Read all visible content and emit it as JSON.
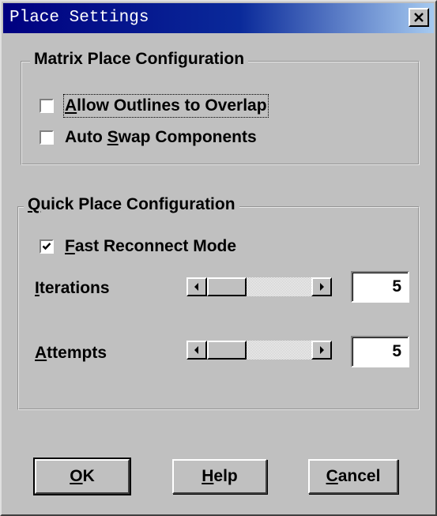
{
  "window": {
    "title": "Place Settings",
    "close_icon": "close-icon"
  },
  "matrix": {
    "title": "Matrix Place Configuration",
    "allow_outlines": {
      "pre": "",
      "mn": "A",
      "post": "llow Outlines to Overlap",
      "checked": false
    },
    "auto_swap": {
      "pre": "Auto ",
      "mn": "S",
      "post": "wap Components",
      "checked": false
    }
  },
  "quick": {
    "title_mn": "Q",
    "title_post": "uick Place Configuration",
    "fast_reconnect": {
      "mn": "F",
      "post": "ast Reconnect Mode",
      "checked": true
    },
    "iterations": {
      "label_mn": "I",
      "label_post": "terations",
      "value": "5"
    },
    "attempts": {
      "label_mn": "A",
      "label_post": "ttempts",
      "value": "5"
    }
  },
  "buttons": {
    "ok": {
      "mn": "O",
      "post": "K"
    },
    "help": {
      "mn": "H",
      "post": "elp"
    },
    "cancel": {
      "mn": "C",
      "post": "ancel"
    }
  }
}
